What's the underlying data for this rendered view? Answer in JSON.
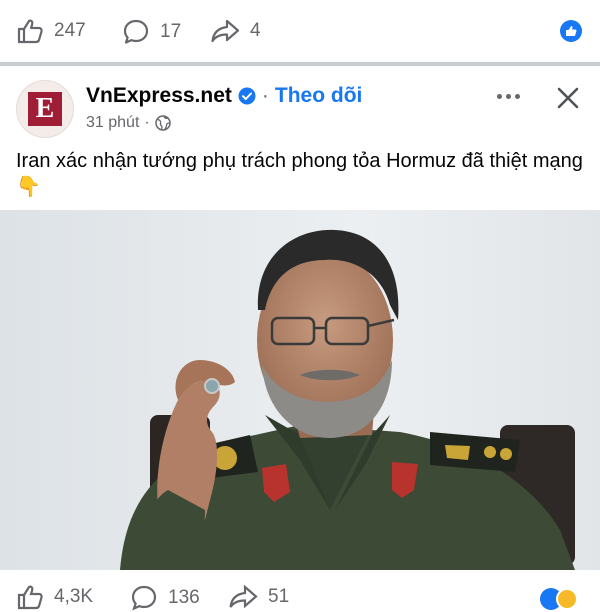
{
  "top_bar": {
    "like_count": "247",
    "comment_count": "17",
    "share_count": "4",
    "like_icon": "thumbs-up-icon",
    "comment_icon": "comment-icon",
    "share_icon": "share-icon",
    "reaction_badge_icon": "like-reaction-icon"
  },
  "post": {
    "page_name": "VnExpress.net",
    "separator": "·",
    "follow_label": "Theo dõi",
    "time": "31 phút",
    "privacy_icon": "globe-icon",
    "avatar_letter": "E",
    "caption": "Iran xác nhận tướng phụ trách phong tỏa Hormuz đã thiệt mạng 👇",
    "image_icon": "photo-of-general"
  },
  "bottom_bar": {
    "like_count": "4,3K",
    "comment_count": "136",
    "share_count": "51"
  },
  "colors": {
    "accent": "#1877f2",
    "text_secondary": "#65676b",
    "brand": "#9f1d35",
    "uniform": "#3c4a36"
  }
}
